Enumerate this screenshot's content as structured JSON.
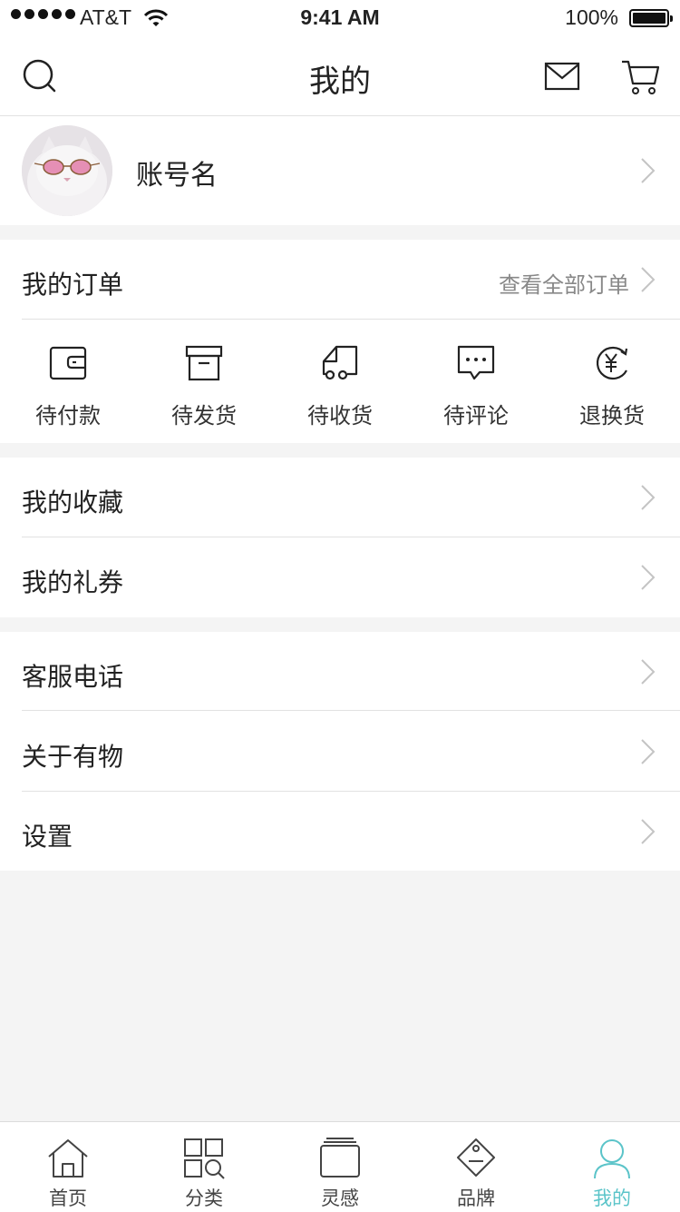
{
  "status_bar": {
    "carrier": "AT&T",
    "time": "9:41 AM",
    "battery": "100%"
  },
  "nav": {
    "title": "我的",
    "left_icon": "search-icon",
    "right_icons": [
      "mail-icon",
      "cart-icon"
    ]
  },
  "profile": {
    "account_name": "账号名"
  },
  "orders": {
    "title": "我的订单",
    "view_all": "查看全部订单",
    "items": [
      {
        "label": "待付款",
        "icon": "wallet-icon"
      },
      {
        "label": "待发货",
        "icon": "box-icon"
      },
      {
        "label": "待收货",
        "icon": "truck-icon"
      },
      {
        "label": "待评论",
        "icon": "comment-icon"
      },
      {
        "label": "退换货",
        "icon": "refund-icon"
      }
    ]
  },
  "group1": [
    {
      "label": "我的收藏"
    },
    {
      "label": "我的礼券"
    }
  ],
  "group2": [
    {
      "label": "客服电话"
    },
    {
      "label": "关于有物"
    },
    {
      "label": "设置"
    }
  ],
  "tabbar": {
    "active_color": "#5bc4c9",
    "items": [
      {
        "label": "首页",
        "icon": "home-icon"
      },
      {
        "label": "分类",
        "icon": "category-icon"
      },
      {
        "label": "灵感",
        "icon": "inspiration-icon"
      },
      {
        "label": "品牌",
        "icon": "brand-tag-icon"
      },
      {
        "label": "我的",
        "icon": "profile-icon"
      }
    ]
  }
}
